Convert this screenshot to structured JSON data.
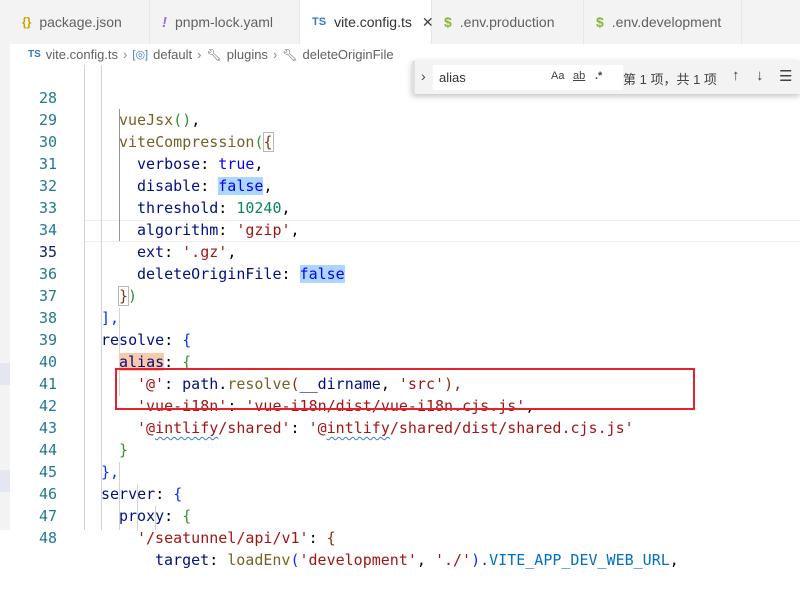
{
  "tabs": [
    {
      "icon": "{}",
      "label": "package.json"
    },
    {
      "icon": "!",
      "label": "pnpm-lock.yaml"
    },
    {
      "icon": "TS",
      "label": "vite.config.ts"
    },
    {
      "icon": "$",
      "label": ".env.production"
    },
    {
      "icon": "$",
      "label": ".env.development"
    }
  ],
  "tab_close": "✕",
  "breadcrumb": {
    "file_icon": "TS",
    "file": "vite.config.ts",
    "symbol_icon": "[◎]",
    "items": [
      "default",
      "plugins",
      "deleteOriginFile"
    ],
    "sep": "›"
  },
  "find": {
    "value": "alias",
    "match_case": "Aa",
    "whole_word": "ab",
    "regex": ".*",
    "status": "第 1 项，共 1 项"
  },
  "lines": [
    {
      "n": "28",
      "tokens": [
        "vueJsx",
        "()",
        ","
      ]
    },
    {
      "n": "29",
      "tokens": [
        "viteCompression",
        "(",
        "{"
      ]
    },
    {
      "n": "30",
      "tokens": [
        "verbose",
        ": ",
        "true",
        ","
      ]
    },
    {
      "n": "31",
      "tokens": [
        "disable",
        ": ",
        "false",
        ","
      ]
    },
    {
      "n": "32",
      "tokens": [
        "threshold",
        ": ",
        "10240",
        ","
      ]
    },
    {
      "n": "33",
      "tokens": [
        "algorithm",
        ": ",
        "'gzip'",
        ","
      ]
    },
    {
      "n": "34",
      "tokens": [
        "ext",
        ": ",
        "'.gz'",
        ","
      ]
    },
    {
      "n": "35",
      "tokens": [
        "deleteOriginFile",
        ": ",
        "false"
      ]
    },
    {
      "n": "36",
      "tokens": [
        "}",
        ")"
      ]
    },
    {
      "n": "37",
      "tokens": [
        "],"
      ]
    },
    {
      "n": "38",
      "tokens": [
        "resolve",
        ": ",
        "{"
      ]
    },
    {
      "n": "39",
      "tokens": [
        "alias",
        ": ",
        "{"
      ]
    },
    {
      "n": "40",
      "tokens": [
        "'@'",
        ": ",
        "path",
        ".",
        "resolve",
        "(",
        "__dirname",
        ", ",
        "'src'",
        "),"
      ]
    },
    {
      "n": "41",
      "tokens": [
        "'vue-i18n'",
        ": ",
        "'vue-i18n/dist/vue-i18n.cjs.js'",
        ","
      ]
    },
    {
      "n": "42",
      "tokens": [
        "'@",
        "intlify",
        "/shared'",
        ": ",
        "'@",
        "intlify",
        "/shared/dist/shared.cjs.js'"
      ]
    },
    {
      "n": "43",
      "tokens": [
        "}"
      ]
    },
    {
      "n": "44",
      "tokens": [
        "},"
      ]
    },
    {
      "n": "45",
      "tokens": [
        "server",
        ": ",
        "{"
      ]
    },
    {
      "n": "46",
      "tokens": [
        "proxy",
        ": ",
        "{"
      ]
    },
    {
      "n": "47",
      "tokens": [
        "'/seatunnel/api/v1'",
        ": ",
        "{"
      ]
    },
    {
      "n": "48",
      "tokens": [
        "target",
        ": ",
        "loadEnv",
        "(",
        "'development'",
        ", ",
        "'./'",
        ").",
        "VITE_APP_DEV_WEB_URL",
        ","
      ]
    }
  ]
}
